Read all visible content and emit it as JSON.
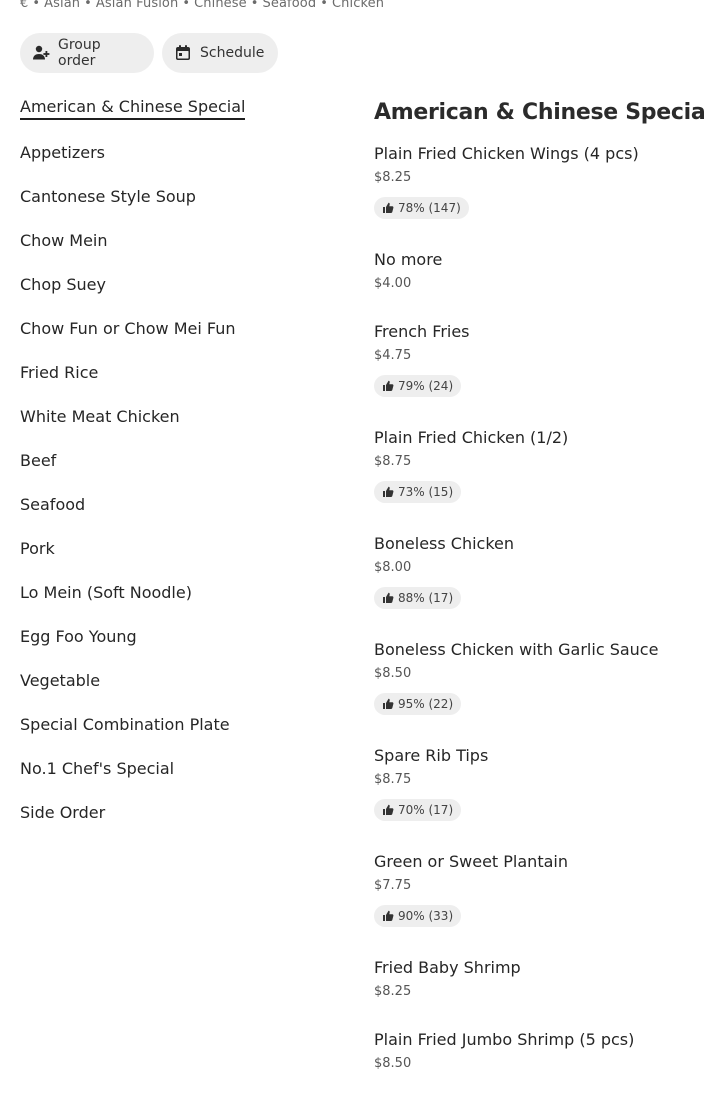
{
  "store_tags": {
    "price": "€",
    "cuisines": [
      "Asian",
      "Asian Fusion",
      "Chinese",
      "Seafood",
      "Chicken"
    ]
  },
  "actions": {
    "group_order": "Group order",
    "schedule": "Schedule"
  },
  "sidebar": {
    "items": [
      {
        "label": "American & Chinese Special",
        "active": true
      },
      {
        "label": "Appetizers"
      },
      {
        "label": "Cantonese Style Soup"
      },
      {
        "label": "Chow Mein"
      },
      {
        "label": "Chop Suey"
      },
      {
        "label": "Chow Fun or Chow Mei Fun"
      },
      {
        "label": "Fried Rice"
      },
      {
        "label": "White Meat Chicken"
      },
      {
        "label": "Beef"
      },
      {
        "label": "Seafood"
      },
      {
        "label": "Pork"
      },
      {
        "label": "Lo Mein (Soft Noodle)"
      },
      {
        "label": "Egg Foo Young"
      },
      {
        "label": "Vegetable"
      },
      {
        "label": "Special Combination Plate"
      },
      {
        "label": "No.1 Chef's Special"
      },
      {
        "label": "Side Order"
      }
    ]
  },
  "menu": {
    "section_title": "American & Chinese Special",
    "items": [
      {
        "name": "Plain Fried Chicken Wings (4 pcs)",
        "price": "$8.25",
        "rating": "78% (147)"
      },
      {
        "name": "No more",
        "price": "$4.00",
        "rating": ""
      },
      {
        "name": "French Fries",
        "price": "$4.75",
        "rating": "79% (24)"
      },
      {
        "name": "Plain Fried Chicken (1/2)",
        "price": "$8.75",
        "rating": "73% (15)"
      },
      {
        "name": "Boneless Chicken",
        "price": "$8.00",
        "rating": "88% (17)"
      },
      {
        "name": "Boneless Chicken with Garlic Sauce",
        "price": "$8.50",
        "rating": "95% (22)"
      },
      {
        "name": "Spare Rib Tips",
        "price": "$8.75",
        "rating": "70% (17)"
      },
      {
        "name": "Green or Sweet Plantain",
        "price": "$7.75",
        "rating": "90% (33)"
      },
      {
        "name": "Fried Baby Shrimp",
        "price": "$8.25",
        "rating": ""
      },
      {
        "name": "Plain Fried Jumbo Shrimp (5 pcs)",
        "price": "$8.50",
        "rating": ""
      }
    ]
  }
}
